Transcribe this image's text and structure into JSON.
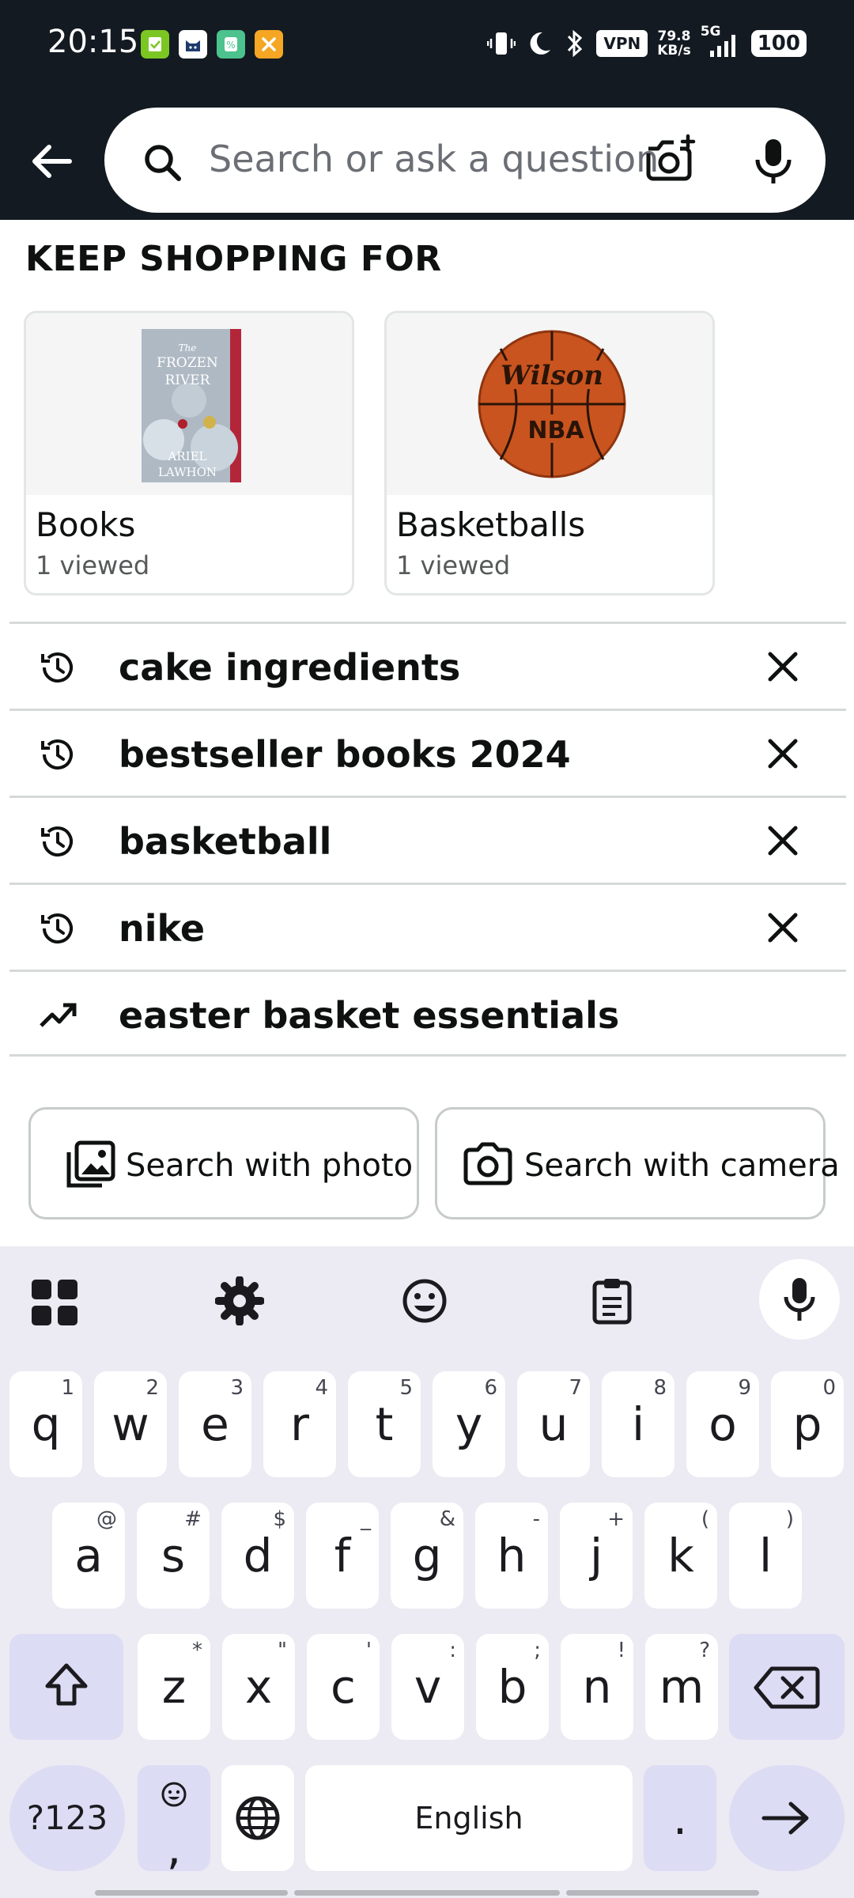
{
  "status_bar": {
    "time": "20:15",
    "vpn": "VPN",
    "speed_value": "79.8",
    "speed_unit": "KB/s",
    "network": "5G",
    "battery": "100"
  },
  "header": {
    "search_placeholder": "Search or ask a question"
  },
  "keep_shopping": {
    "title": "KEEP SHOPPING FOR",
    "cards": [
      {
        "title": "Books",
        "subtitle": "1 viewed",
        "image_icon": "book-cover-frozen-river"
      },
      {
        "title": "Basketballs",
        "subtitle": "1 viewed",
        "image_icon": "wilson-nba-basketball"
      }
    ]
  },
  "book_cover": {
    "line1": "The",
    "line2": "FROZEN",
    "line3": "RIVER",
    "line4": "ARIEL",
    "line5": "LAWHON"
  },
  "ball_brand": {
    "brand": "Wilson",
    "league": "NBA"
  },
  "suggestions": [
    {
      "text": "cake ingredients",
      "icon": "history-icon",
      "removable": true
    },
    {
      "text": "bestseller books 2024",
      "icon": "history-icon",
      "removable": true
    },
    {
      "text": "basketball",
      "icon": "history-icon",
      "removable": true
    },
    {
      "text": "nike",
      "icon": "history-icon",
      "removable": true
    },
    {
      "text": "easter basket essentials",
      "icon": "trending-icon",
      "removable": false
    }
  ],
  "search_buttons": {
    "photo": "Search with photo",
    "camera": "Search with camera"
  },
  "keyboard": {
    "row1": [
      [
        "q",
        "1"
      ],
      [
        "w",
        "2"
      ],
      [
        "e",
        "3"
      ],
      [
        "r",
        "4"
      ],
      [
        "t",
        "5"
      ],
      [
        "y",
        "6"
      ],
      [
        "u",
        "7"
      ],
      [
        "i",
        "8"
      ],
      [
        "o",
        "9"
      ],
      [
        "p",
        "0"
      ]
    ],
    "row2": [
      [
        "a",
        "@"
      ],
      [
        "s",
        "#"
      ],
      [
        "d",
        "$"
      ],
      [
        "f",
        "_"
      ],
      [
        "g",
        "&"
      ],
      [
        "h",
        "-"
      ],
      [
        "j",
        "+"
      ],
      [
        "k",
        "("
      ],
      [
        "l",
        ")"
      ]
    ],
    "row3": [
      [
        "z",
        "*"
      ],
      [
        "x",
        "\""
      ],
      [
        "c",
        "'"
      ],
      [
        "v",
        ":"
      ],
      [
        "b",
        ";"
      ],
      [
        "n",
        "!"
      ],
      [
        "m",
        "?"
      ]
    ],
    "symbols_key": "?123",
    "comma_key": ",",
    "space_label": "English",
    "period_key": "."
  },
  "colors": {
    "topbar": "#131a22",
    "keyboard_bg": "#eceaf2",
    "special_key": "#dcdcf4"
  }
}
